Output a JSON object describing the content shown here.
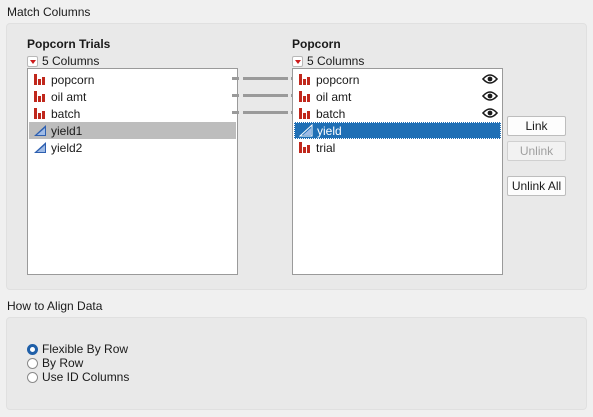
{
  "match_columns": {
    "title": "Match Columns",
    "left": {
      "title": "Popcorn Trials",
      "count": "5 Columns",
      "items": [
        {
          "label": "popcorn",
          "type": "nominal",
          "selected": false
        },
        {
          "label": "oil amt",
          "type": "nominal",
          "selected": false
        },
        {
          "label": "batch",
          "type": "nominal",
          "selected": false
        },
        {
          "label": "yield1",
          "type": "continuous",
          "selected": true
        },
        {
          "label": "yield2",
          "type": "continuous",
          "selected": false
        }
      ]
    },
    "right": {
      "title": "Popcorn",
      "count": "5 Columns",
      "items": [
        {
          "label": "popcorn",
          "type": "nominal",
          "linked": true
        },
        {
          "label": "oil amt",
          "type": "nominal",
          "linked": true
        },
        {
          "label": "batch",
          "type": "nominal",
          "linked": true
        },
        {
          "label": "yield",
          "type": "continuous",
          "selected": true
        },
        {
          "label": "trial",
          "type": "nominal"
        }
      ]
    },
    "buttons": {
      "link": "Link",
      "unlink": "Unlink",
      "unlink_all": "Unlink All"
    }
  },
  "align": {
    "title": "How to Align Data",
    "options": [
      {
        "label": "Flexible By Row",
        "selected": true
      },
      {
        "label": "By Row",
        "selected": false
      },
      {
        "label": "Use ID Columns",
        "selected": false
      }
    ]
  },
  "colors": {
    "selection_blue": "#1f6fb5",
    "selection_gray": "#bdbdbd",
    "nominal_icon": "#c0281c",
    "continuous_icon": "#2d5fb0"
  }
}
